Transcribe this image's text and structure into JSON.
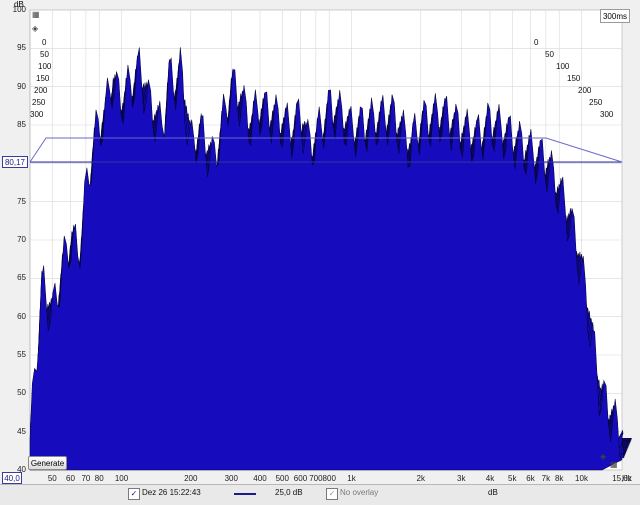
{
  "window": {
    "db_unit": "dB",
    "hz_unit": "Hz",
    "time_window": "300ms",
    "generate_label": "Generate",
    "value_box": "80,17",
    "floor_box": "40,0"
  },
  "axes": {
    "y_ticks": [
      "100",
      "95",
      "90",
      "85",
      "80",
      "75",
      "70",
      "65",
      "60",
      "55",
      "50",
      "45",
      "40"
    ],
    "x_ticks": [
      "50",
      "60",
      "70",
      "80",
      "100",
      "200",
      "300",
      "400",
      "500",
      "600",
      "700",
      "800",
      "1k",
      "2k",
      "3k",
      "4k",
      "5k",
      "6k",
      "7k",
      "8k",
      "10k",
      "15,0k"
    ],
    "depth_ticks_left": [
      "0",
      "50",
      "100",
      "150",
      "200",
      "250",
      "300"
    ],
    "depth_ticks_right": [
      "0",
      "50",
      "100",
      "150",
      "200",
      "250",
      "300"
    ]
  },
  "statusbar": {
    "measurement": "Dez 26 15:22:43",
    "range": "25,0 dB",
    "overlay": "No overlay",
    "unit": "dB"
  },
  "chart_data": {
    "type": "area",
    "title": "",
    "xlabel": "Hz",
    "ylabel": "dB",
    "x_scale": "log",
    "xlim": [
      40,
      15000
    ],
    "ylim": [
      40,
      100
    ],
    "z_label": "ms",
    "z_range": [
      0,
      300
    ],
    "series": [
      {
        "name": "Dez 26 15:22:43",
        "color": "#1a10b8",
        "x": [
          40,
          45,
          50,
          55,
          60,
          65,
          70,
          75,
          80,
          85,
          90,
          95,
          100,
          110,
          120,
          130,
          140,
          150,
          160,
          170,
          180,
          200,
          220,
          250,
          280,
          300,
          330,
          360,
          400,
          450,
          500,
          550,
          600,
          650,
          700,
          800,
          900,
          1000,
          1200,
          1500,
          1800,
          2000,
          2500,
          3000,
          3500,
          4000,
          4500,
          5000,
          5500,
          6000,
          7000,
          8000,
          9000,
          10000,
          11000,
          12000,
          15000
        ],
        "values": [
          44,
          64,
          60,
          66,
          70,
          68,
          76,
          82,
          85,
          86,
          91,
          89,
          88,
          90,
          92,
          88,
          86,
          84,
          91,
          90,
          92,
          82,
          84,
          80,
          86,
          90,
          88,
          85,
          87,
          86,
          85,
          84,
          86,
          82,
          83,
          87,
          86,
          84,
          85,
          86,
          82,
          85,
          86,
          84,
          83,
          85,
          84,
          83,
          82,
          81,
          80,
          76,
          72,
          66,
          58,
          50,
          44
        ]
      }
    ],
    "threshold": 80.17,
    "grid": true
  },
  "colors": {
    "waterfall": "#1a10b8",
    "outline": "#050535",
    "threshold_line": "#3030a0",
    "background": "#ffffff"
  }
}
